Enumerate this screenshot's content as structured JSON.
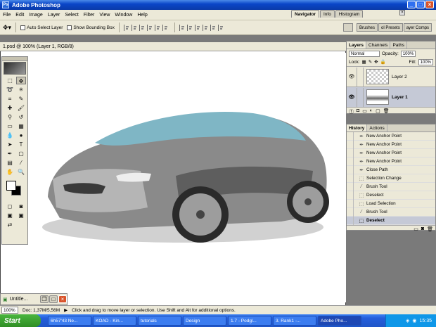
{
  "window": {
    "title": "Adobe Photoshop"
  },
  "menu": [
    "File",
    "Edit",
    "Image",
    "Layer",
    "Select",
    "Filter",
    "View",
    "Window",
    "Help"
  ],
  "options": {
    "auto_select": "Auto Select Layer",
    "bounding_box": "Show Bounding Box"
  },
  "nav_tabs": [
    "Navigator",
    "Info",
    "Histogram"
  ],
  "well_tabs": [
    "Brushes",
    "ol Presets",
    "ayer Comps"
  ],
  "document": {
    "title": "1.psd @ 100% (Layer 1, RGB/8)"
  },
  "layers_panel": {
    "tabs": [
      "Layers",
      "Channels",
      "Paths"
    ],
    "blend_mode": "Normal",
    "opacity_label": "Opacity:",
    "opacity": "100%",
    "lock_label": "Lock:",
    "fill_label": "Fill:",
    "fill": "100%",
    "layers": [
      {
        "name": "Layer 2"
      },
      {
        "name": "Layer 1"
      }
    ]
  },
  "history_panel": {
    "tabs": [
      "History",
      "Actions"
    ],
    "items": [
      "New Anchor Point",
      "New Anchor Point",
      "New Anchor Point",
      "New Anchor Point",
      "Close Path",
      "Selection Change",
      "Brush Tool",
      "Deselect",
      "Load Selection",
      "Brush Tool",
      "Deselect"
    ]
  },
  "minimized_doc": {
    "title": "Untitle..."
  },
  "status": {
    "zoom": "100%",
    "doc": "Doc: 1,37M/5,56M",
    "hint": "Click and drag to move layer or selection.  Use Shift and Alt for additional options."
  },
  "taskbar": {
    "start": "Start",
    "buttons": [
      "6h57'43 Ne...",
      "KOAD - Kin...",
      "tutorials",
      "Design",
      "1.7 - Podgl...",
      "3. Rank1 -...",
      "Adobe Pho..."
    ],
    "time": "15:35"
  }
}
